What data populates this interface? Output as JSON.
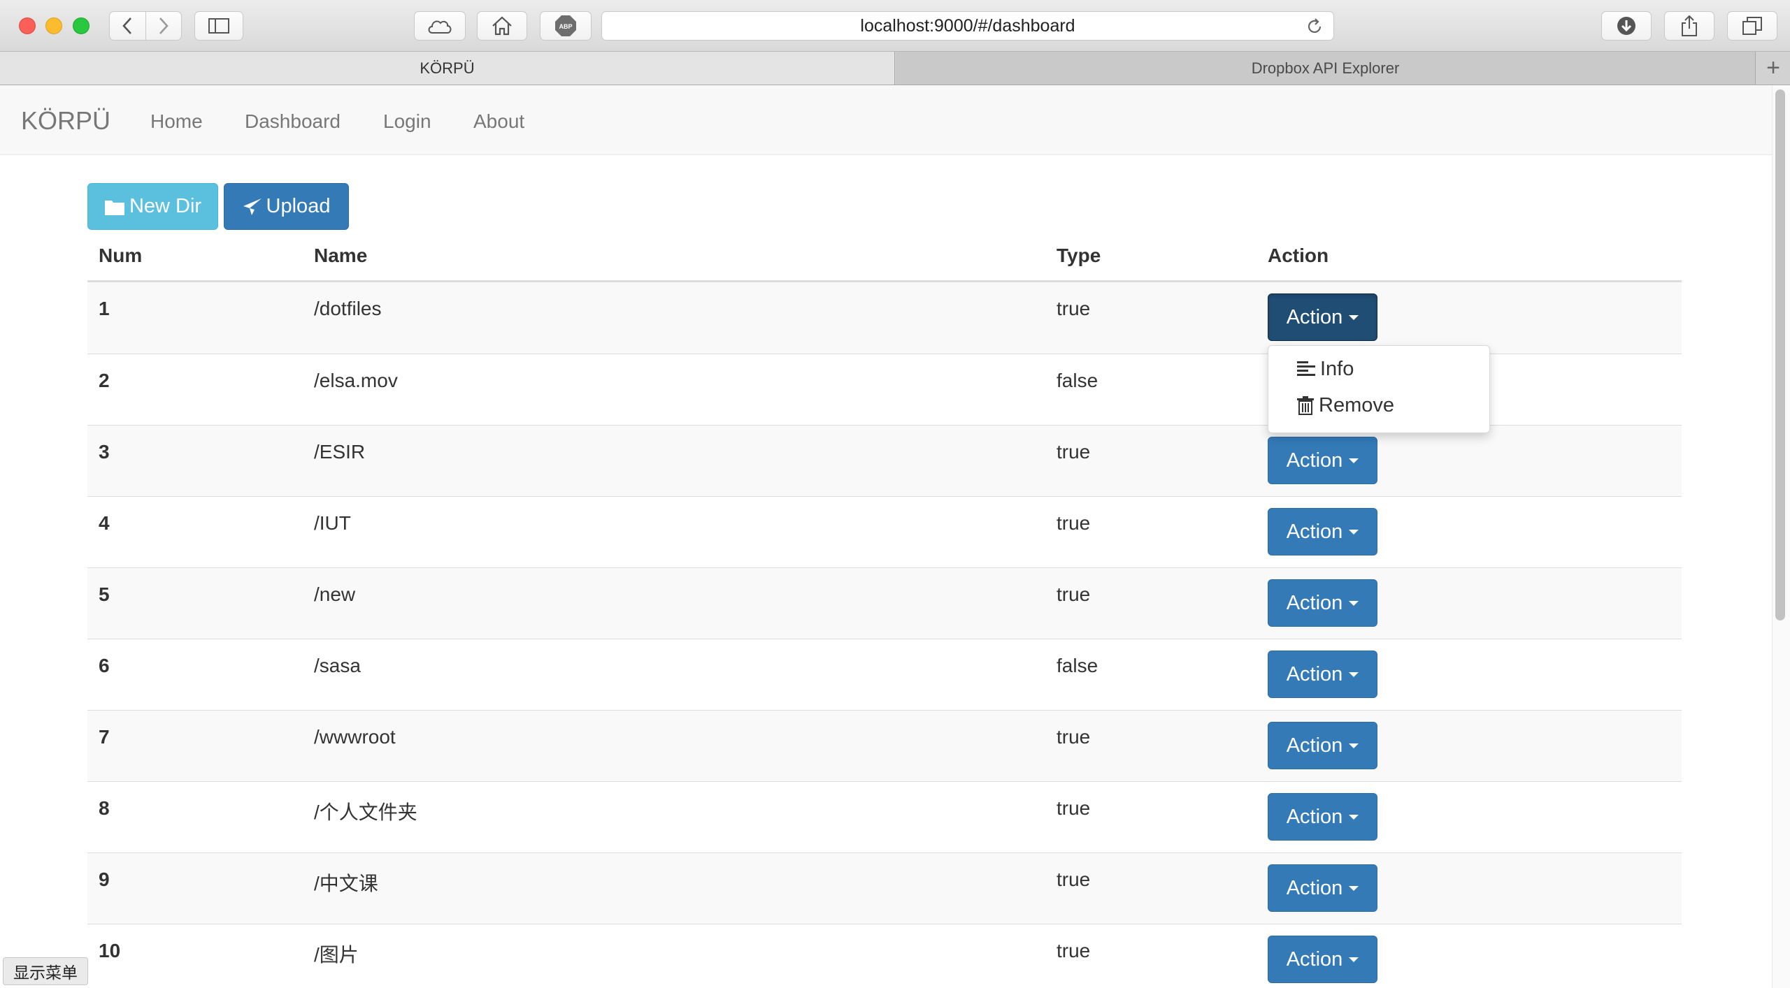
{
  "browser": {
    "url": "localhost:9000/#/dashboard",
    "tabs": [
      {
        "label": "KÖRPÜ",
        "active": true
      },
      {
        "label": "Dropbox API Explorer",
        "active": false
      }
    ],
    "new_tab_label": "+"
  },
  "navbar": {
    "brand": "KÖRPÜ",
    "links": [
      "Home",
      "Dashboard",
      "Login",
      "About"
    ]
  },
  "toolbar": {
    "new_dir_label": "New Dir",
    "upload_label": "Upload"
  },
  "table": {
    "headers": [
      "Num",
      "Name",
      "Type",
      "Action"
    ],
    "rows": [
      {
        "num": "1",
        "name": "/dotfiles",
        "type": "true",
        "action": "Action"
      },
      {
        "num": "2",
        "name": "/elsa.mov",
        "type": "false",
        "action": "Action"
      },
      {
        "num": "3",
        "name": "/ESIR",
        "type": "true",
        "action": "Action"
      },
      {
        "num": "4",
        "name": "/IUT",
        "type": "true",
        "action": "Action"
      },
      {
        "num": "5",
        "name": "/new",
        "type": "true",
        "action": "Action"
      },
      {
        "num": "6",
        "name": "/sasa",
        "type": "false",
        "action": "Action"
      },
      {
        "num": "7",
        "name": "/wwwroot",
        "type": "true",
        "action": "Action"
      },
      {
        "num": "8",
        "name": "/个人文件夹",
        "type": "true",
        "action": "Action"
      },
      {
        "num": "9",
        "name": "/中文课",
        "type": "true",
        "action": "Action"
      },
      {
        "num": "10",
        "name": "/图片",
        "type": "true",
        "action": "Action"
      }
    ]
  },
  "dropdown": {
    "items": [
      {
        "label": "Info",
        "icon": "align-left-icon"
      },
      {
        "label": "Remove",
        "icon": "trash-icon"
      }
    ]
  },
  "status": {
    "menu_hint": "显示菜单"
  },
  "colors": {
    "primary": "#337ab7",
    "primary_active": "#204d74",
    "info": "#5bc0de",
    "navbar_bg": "#f8f8f8"
  }
}
